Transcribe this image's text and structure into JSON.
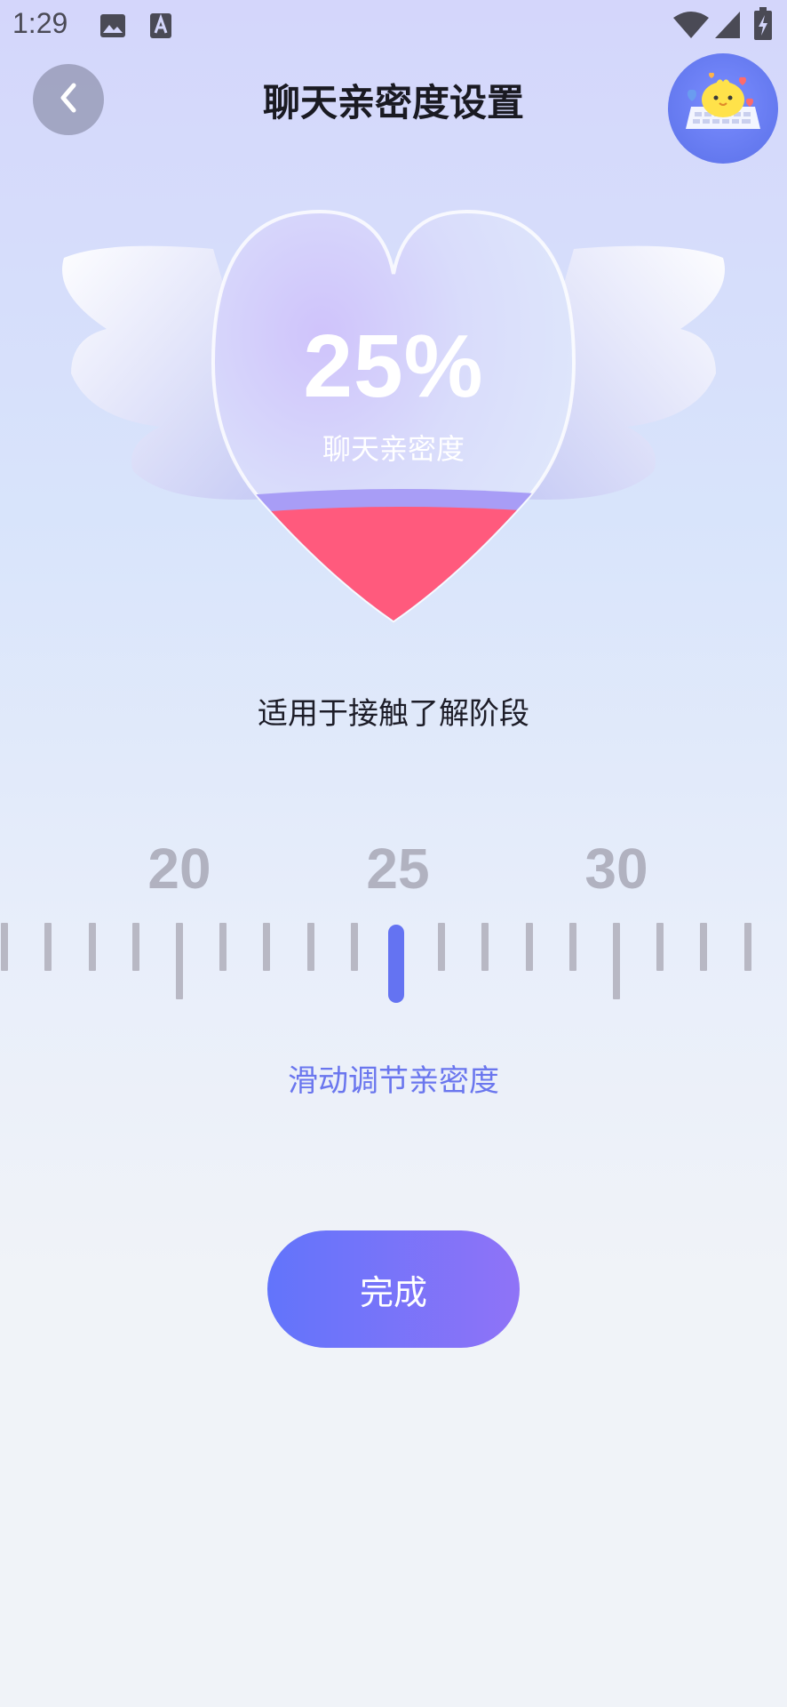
{
  "status_bar": {
    "time": "1:29",
    "icons": [
      "image-icon",
      "font-a-icon",
      "wifi-icon",
      "signal-icon",
      "battery-charging-icon"
    ]
  },
  "header": {
    "title": "聊天亲密度设置",
    "back_icon": "chevron-left-icon",
    "mascot_icon": "chick-keyboard-mascot-icon"
  },
  "intimacy": {
    "percent_label": "25%",
    "value": 25,
    "caption": "聊天亲密度",
    "stage_description": "适用于接触了解阶段",
    "fill_color": "#ff5a7d"
  },
  "ruler": {
    "labels": [
      "20",
      "25",
      "30"
    ],
    "selected": 25,
    "hint": "滑动调节亲密度",
    "indicator_color": "#6473f2"
  },
  "actions": {
    "done_label": "完成"
  },
  "colors": {
    "accent": "#6473f2",
    "accent_end": "#8f73f7",
    "tick": "#b8b8c4"
  }
}
